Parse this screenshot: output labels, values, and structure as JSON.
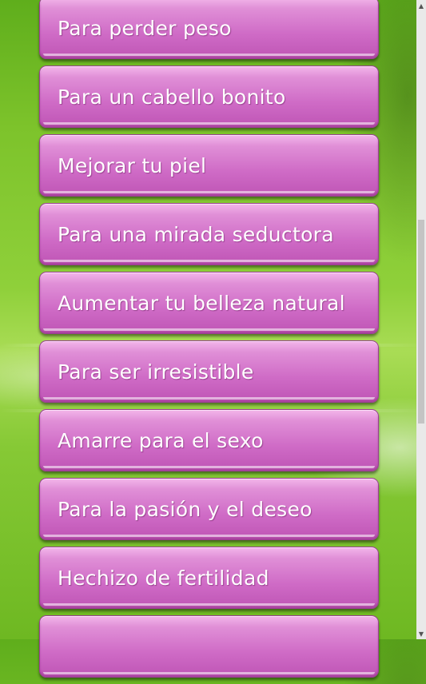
{
  "menu": {
    "items": [
      {
        "label": "Para perder peso"
      },
      {
        "label": "Para un cabello bonito"
      },
      {
        "label": "Mejorar tu piel"
      },
      {
        "label": "Para una mirada seductora"
      },
      {
        "label": "Aumentar tu belleza natural"
      },
      {
        "label": "Para ser irresistible"
      },
      {
        "label": "Amarre para el sexo"
      },
      {
        "label": "Para la pasión y el deseo"
      },
      {
        "label": "Hechizo de fertilidad"
      },
      {
        "label": ""
      }
    ]
  },
  "scrollbar": {
    "up_icon": "triangle-up-icon",
    "down_icon": "triangle-down-icon"
  },
  "colors": {
    "button_top": "#f3b6ea",
    "button_bottom": "#bf55b5",
    "background_green": "#7dc32b",
    "text": "#ffffff"
  }
}
